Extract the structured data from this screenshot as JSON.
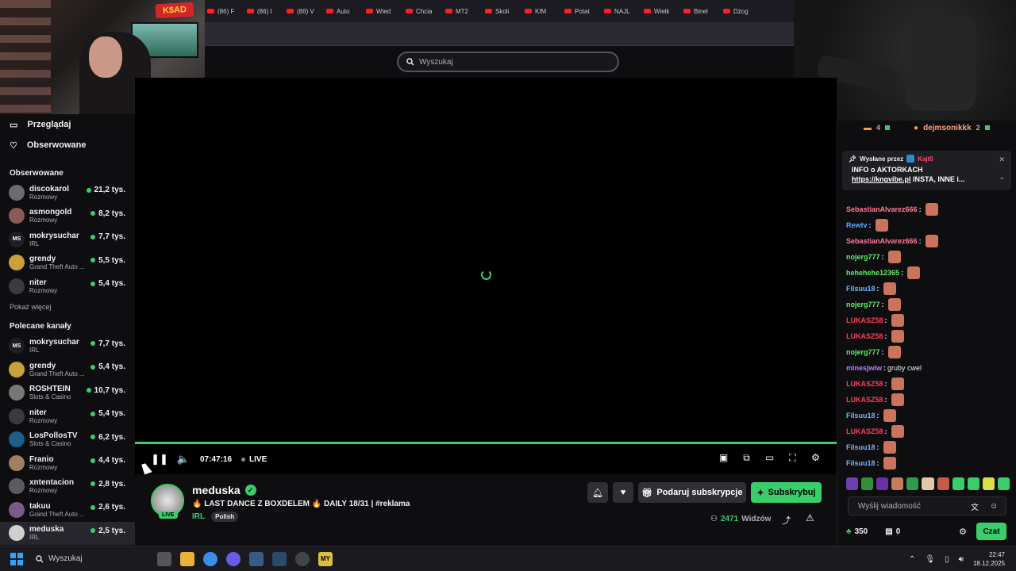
{
  "browser": {
    "tabs": [
      "(86) F",
      "(86) I",
      "(86) V",
      "Auto",
      "Wied",
      "Chcia",
      "MT2",
      "Skoli",
      "KIM",
      "Potat",
      "NAJL",
      "Wielk",
      "Binel",
      "Dżog"
    ]
  },
  "webcam": {
    "logo": "K$AD"
  },
  "header": {
    "search_placeholder": "Wyszukaj"
  },
  "sidebar": {
    "nav": [
      {
        "label": "Przeglądaj",
        "icon": "browse-icon"
      },
      {
        "label": "Obserwowane",
        "icon": "heart-icon"
      }
    ],
    "followed_title": "Obserwowane",
    "followed": [
      {
        "name": "discokarol",
        "category": "Rozmowy",
        "viewers": "21,2 tys.",
        "avatar_color": "#6b6b73"
      },
      {
        "name": "asmongold",
        "category": "Rozmowy",
        "viewers": "8,2 tys.",
        "avatar_color": "#8a5a5a"
      },
      {
        "name": "mokrysuchar",
        "category": "IRL",
        "viewers": "7,7 tys.",
        "avatar_color": "#1e1e24",
        "avatar_text": "MS"
      },
      {
        "name": "grendy",
        "category": "Grand Theft Auto ...",
        "viewers": "5,5 tys.",
        "avatar_color": "#c9a13a"
      },
      {
        "name": "niter",
        "category": "Rozmowy",
        "viewers": "5,4 tys.",
        "avatar_color": "#3a3a40"
      }
    ],
    "show_more": "Pokaż więcej",
    "recommended_title": "Polecane kanały",
    "recommended": [
      {
        "name": "mokrysuchar",
        "category": "IRL",
        "viewers": "7,7 tys.",
        "avatar_color": "#1e1e24",
        "avatar_text": "MS"
      },
      {
        "name": "grendy",
        "category": "Grand Theft Auto ...",
        "viewers": "5,4 tys.",
        "avatar_color": "#c9a13a"
      },
      {
        "name": "ROSHTEIN",
        "category": "Slots & Casino",
        "viewers": "10,7 tys.",
        "avatar_color": "#777777"
      },
      {
        "name": "niter",
        "category": "Rozmowy",
        "viewers": "5,4 tys.",
        "avatar_color": "#3a3a40"
      },
      {
        "name": "LosPollosTV",
        "category": "Slots & Casino",
        "viewers": "6,2 tys.",
        "avatar_color": "#1b5f8a"
      },
      {
        "name": "Franio",
        "category": "Rozmowy",
        "viewers": "4,4 tys.",
        "avatar_color": "#a08060"
      },
      {
        "name": "xntentacion",
        "category": "Rozmowy",
        "viewers": "2,8 tys.",
        "avatar_color": "#5a5a60"
      },
      {
        "name": "takuu",
        "category": "Grand Theft Auto ...",
        "viewers": "2,6 tys.",
        "avatar_color": "#7a5a8a"
      },
      {
        "name": "meduska",
        "category": "IRL",
        "viewers": "2,5 tys.",
        "avatar_color": "#cfcfcf"
      }
    ]
  },
  "player": {
    "time": "07:47:16",
    "live_label": "LIVE",
    "progress": 1.0
  },
  "stream": {
    "channel": "meduska",
    "live_badge": "LIVE",
    "title": "🔥 LAST DANCE Z BOXDELEM 🔥 DAILY 18/31 | #reklama",
    "category": "IRL",
    "tag": "Polish",
    "gift_label": "Podaruj subskrypcje",
    "subscribe_label": "Subskrybuj",
    "viewers": "2471",
    "viewers_label": "Widzów"
  },
  "chat": {
    "top_count": "4",
    "top_user": "dejmsonikkk",
    "top_user_count": "2",
    "pinned_by_label": "Wysłane przez",
    "pinned_by_name": "Kajt0",
    "pinned_text": "INFO o AKTORKACH",
    "pinned_link": "https://kngvibe.pl",
    "pinned_link_rest": " INSTA, INNE i...",
    "messages": [
      {
        "user": "SebastianAlvarez666",
        "color": "#ff7b9c",
        "text": "",
        "emote": true
      },
      {
        "user": "Rewtv",
        "color": "#5ca9ff",
        "text": "",
        "emote": true
      },
      {
        "user": "SebastianAlvarez666",
        "color": "#ff7b9c",
        "text": "",
        "emote": true
      },
      {
        "user": "nojerg777",
        "color": "#5ff06a",
        "text": "",
        "emote": true
      },
      {
        "user": "hehehehe12365",
        "color": "#5ff06a",
        "text": "",
        "emote": true
      },
      {
        "user": "Filsuu18",
        "color": "#6fb5ff",
        "text": "",
        "emote": true
      },
      {
        "user": "nojerg777",
        "color": "#5ff06a",
        "text": "",
        "emote": true
      },
      {
        "user": "LUKASZ58",
        "color": "#ff3b5c",
        "text": "",
        "emote": true
      },
      {
        "user": "LUKASZ58",
        "color": "#ff3b5c",
        "text": "",
        "emote": true
      },
      {
        "user": "nojerg777",
        "color": "#5ff06a",
        "text": "",
        "emote": true
      },
      {
        "user": "minesjwiw",
        "color": "#b77bff",
        "text": "gruby cwel",
        "emote": false
      },
      {
        "user": "LUKASZ58",
        "color": "#ff3b5c",
        "text": "",
        "emote": true
      },
      {
        "user": "LUKASZ58",
        "color": "#ff3b5c",
        "text": "",
        "emote": true
      },
      {
        "user": "Filsuu18",
        "color": "#6fb5ff",
        "text": "",
        "emote": true
      },
      {
        "user": "LUKASZ58",
        "color": "#ff3b5c",
        "text": "",
        "emote": true
      },
      {
        "user": "Filsuu18",
        "color": "#6fb5ff",
        "text": "",
        "emote": true
      },
      {
        "user": "Filsuu18",
        "color": "#6fb5ff",
        "text": "",
        "emote": true
      }
    ],
    "emote_colors": [
      "#6a3fb0",
      "#2f8f3a",
      "#6b2fa8",
      "#c97a5a",
      "#2f9a4a",
      "#e0c7a8",
      "#c95a4a",
      "#3acd6b",
      "#3acd6b",
      "#d8e04a",
      "#3acd6b"
    ],
    "input_placeholder": "Wyślij wiadomość",
    "points": "350",
    "drops": "0",
    "send_label": "Czat"
  },
  "taskbar": {
    "search_label": "Wyszukaj",
    "time": "22:47",
    "date": "18.12.2025"
  },
  "colors": {
    "accent": "#3acd6b",
    "background": "#0e0e10"
  }
}
